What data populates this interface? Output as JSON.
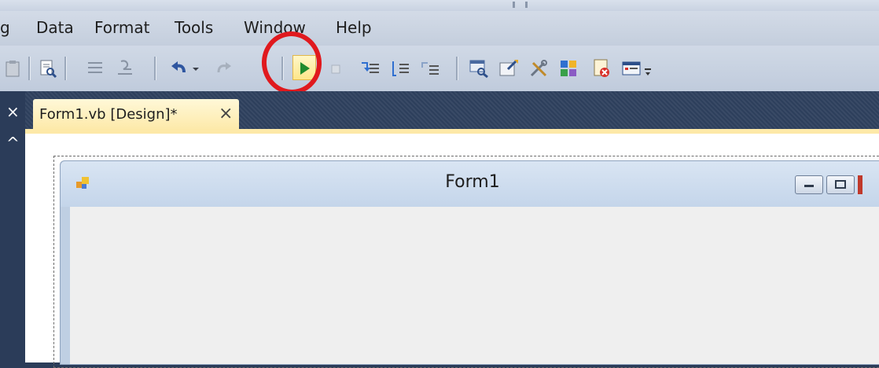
{
  "menu": {
    "items": [
      "g",
      "Data",
      "Format",
      "Tools",
      "Window",
      "Help"
    ]
  },
  "toolbar": {
    "icons": [
      "paste-icon",
      "find-icon",
      "comment-icon",
      "uncomment-icon",
      "undo-icon",
      "dropdown-icon",
      "redo-icon",
      "start-debugging-icon",
      "stop-icon",
      "step-into-icon",
      "step-over-icon",
      "step-out-icon",
      "solution-explorer-icon",
      "properties-icon",
      "toolbox-icon",
      "object-browser-icon",
      "error-list-icon",
      "output-icon",
      "toolbar-options-icon"
    ],
    "run_highlight_color": "#e0191e"
  },
  "left_panel": {
    "close_glyph": "×",
    "up_glyph": "^"
  },
  "document_tab": {
    "label": "Form1.vb [Design]*",
    "close": "×"
  },
  "form": {
    "title": "Form1"
  },
  "colors": {
    "chrome": "#2b3c59",
    "active_tab": "#fde9a8",
    "form_client": "#efefef"
  }
}
